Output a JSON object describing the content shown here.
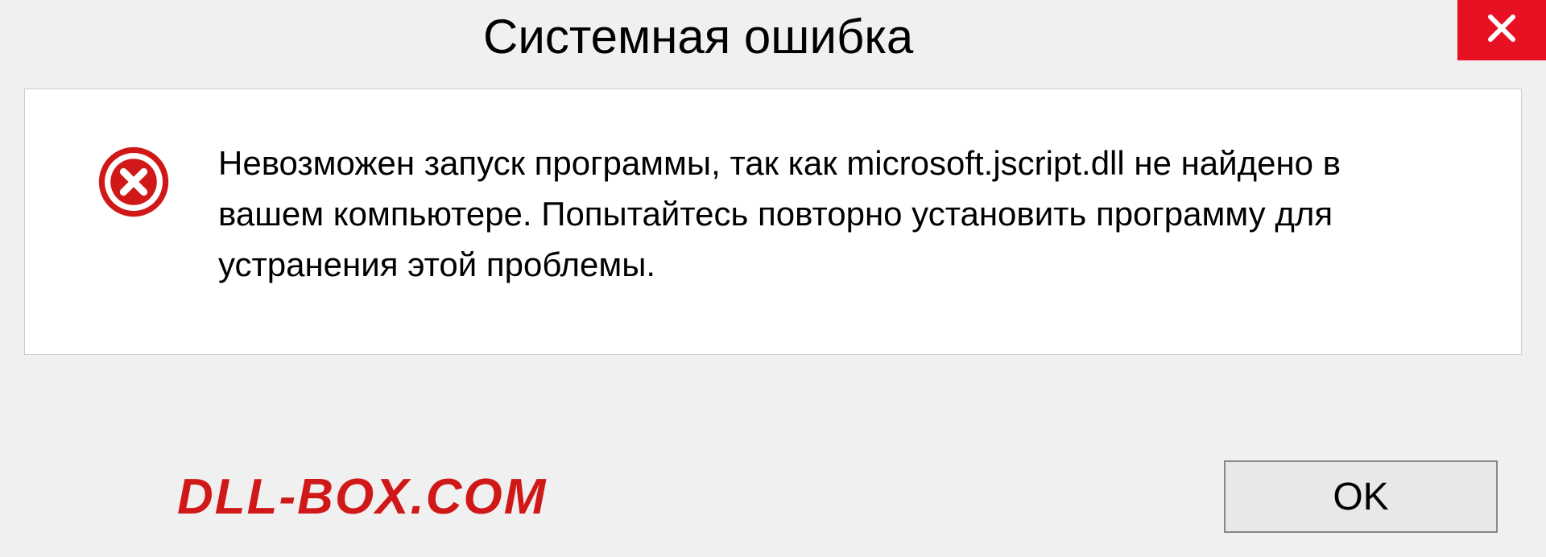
{
  "dialog": {
    "title": "Системная ошибка",
    "message": "Невозможен запуск программы, так как microsoft.jscript.dll  не найдено в вашем компьютере. Попытайтесь повторно установить программу для устранения этой проблемы.",
    "ok_label": "OK"
  },
  "watermark": "DLL-BOX.COM",
  "colors": {
    "close_button": "#e81123",
    "error_icon": "#d01818",
    "watermark": "#d01818"
  }
}
